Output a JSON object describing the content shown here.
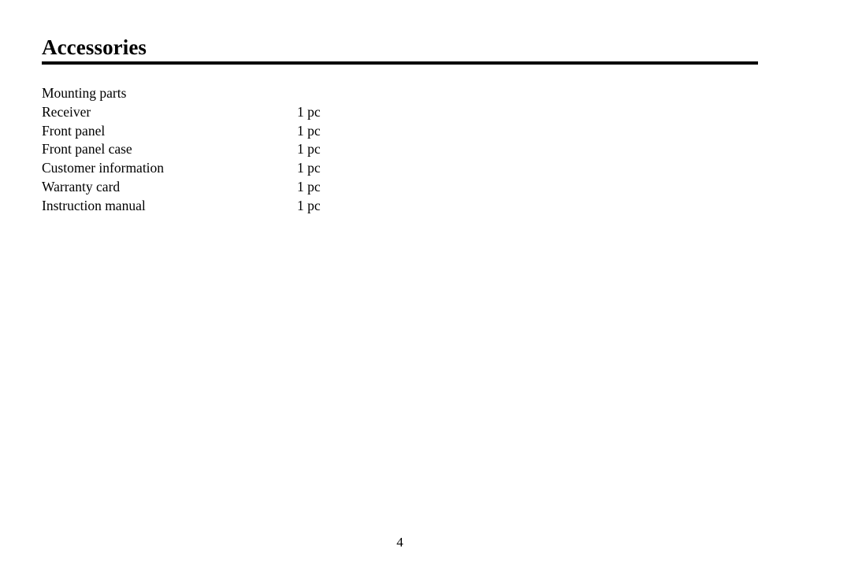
{
  "document": {
    "title": "Accessories",
    "page_number": "4"
  },
  "accessories": {
    "rows": [
      {
        "name": "Mounting parts",
        "qty": ""
      },
      {
        "name": "Receiver",
        "qty": "1 pc"
      },
      {
        "name": "Front panel",
        "qty": "1 pc"
      },
      {
        "name": "Front panel case",
        "qty": "1 pc"
      },
      {
        "name": "Customer information",
        "qty": "1 pc"
      },
      {
        "name": "Warranty card",
        "qty": "1 pc"
      },
      {
        "name": "Instruction manual",
        "qty": "1 pc"
      }
    ]
  },
  "colors": {
    "text": "#000000",
    "rule": "#000000",
    "background": "#ffffff"
  }
}
